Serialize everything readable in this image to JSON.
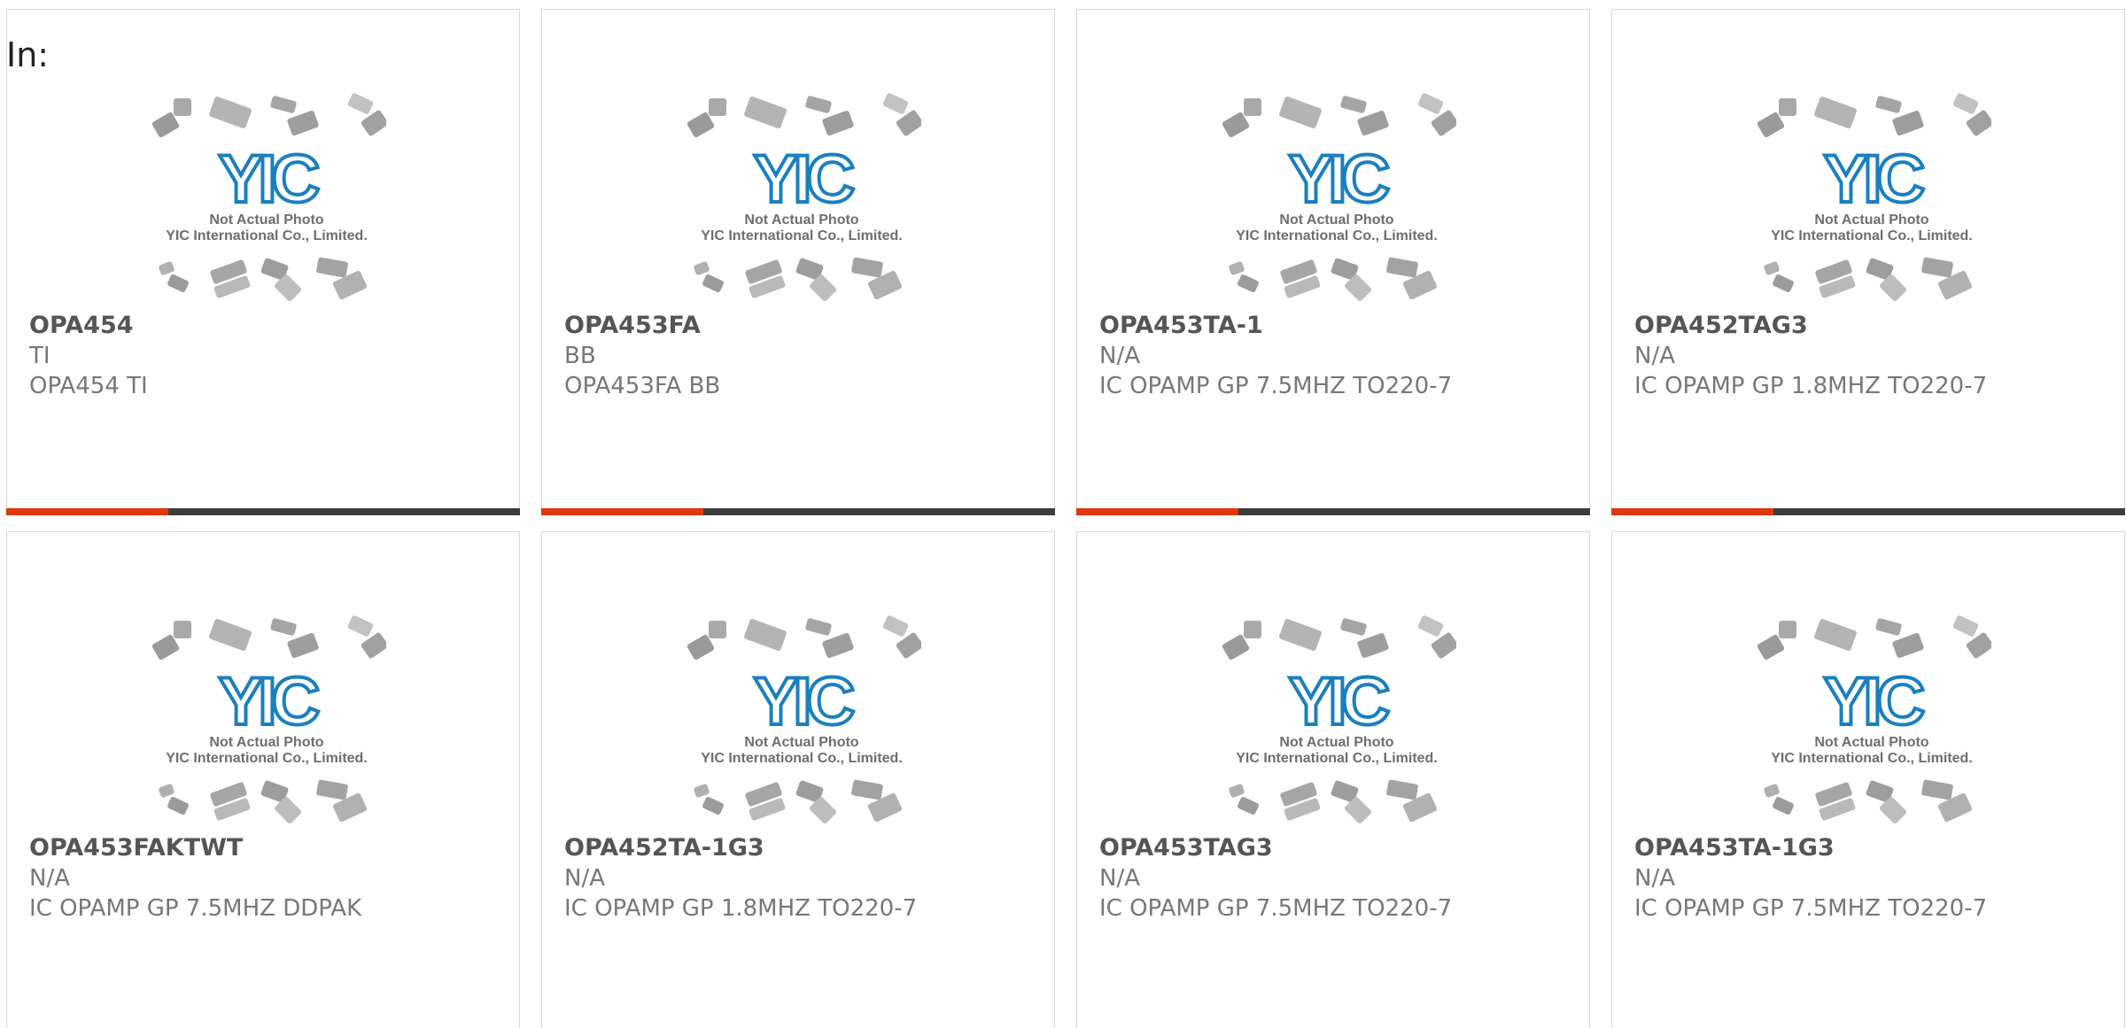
{
  "filter_label": "In:",
  "watermark": {
    "logo_text": "YIC",
    "line1": "Not Actual Photo",
    "line2": "YIC International Co., Limited.",
    "logo_color": "#1a7fbf"
  },
  "colors": {
    "accent_bar": "#e0380c",
    "dark_bar": "#3d3d3d",
    "border": "#d8d8d8",
    "part_number": "#555555",
    "meta_text": "#777777"
  },
  "products": [
    {
      "part_number": "OPA454",
      "manufacturer": "TI",
      "description": "OPA454 TI"
    },
    {
      "part_number": "OPA453FA",
      "manufacturer": "BB",
      "description": "OPA453FA BB"
    },
    {
      "part_number": "OPA453TA-1",
      "manufacturer": "N/A",
      "description": "IC OPAMP GP 7.5MHZ TO220-7"
    },
    {
      "part_number": "OPA452TAG3",
      "manufacturer": "N/A",
      "description": "IC OPAMP GP 1.8MHZ TO220-7"
    },
    {
      "part_number": "OPA453FAKTWT",
      "manufacturer": "N/A",
      "description": "IC OPAMP GP 7.5MHZ DDPAK"
    },
    {
      "part_number": "OPA452TA-1G3",
      "manufacturer": "N/A",
      "description": "IC OPAMP GP 1.8MHZ TO220-7"
    },
    {
      "part_number": "OPA453TAG3",
      "manufacturer": "N/A",
      "description": "IC OPAMP GP 7.5MHZ TO220-7"
    },
    {
      "part_number": "OPA453TA-1G3",
      "manufacturer": "N/A",
      "description": "IC OPAMP GP 7.5MHZ TO220-7"
    }
  ]
}
